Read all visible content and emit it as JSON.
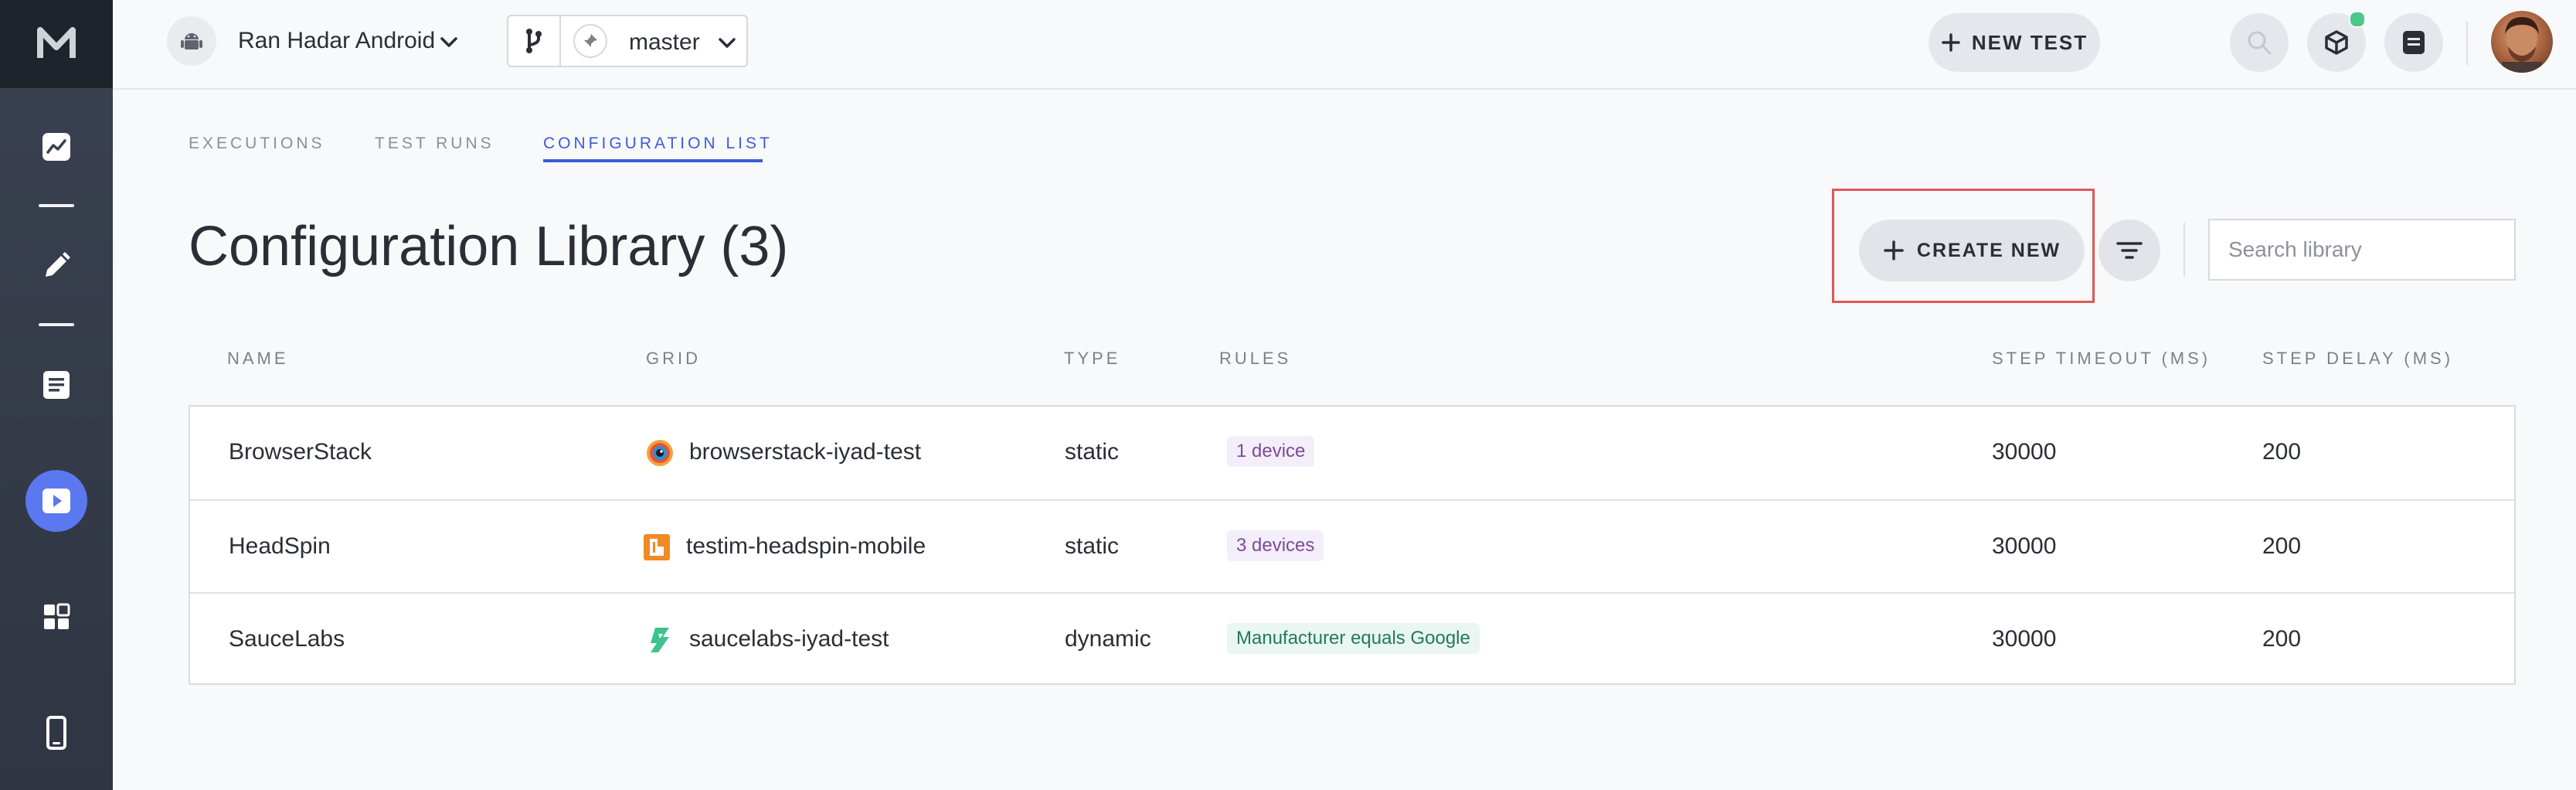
{
  "sidebar": {
    "logo": "M",
    "items": [
      {
        "name": "analytics",
        "icon": "trend-chart-icon"
      },
      {
        "name": "editor",
        "icon": "pencil-icon"
      },
      {
        "name": "tests",
        "icon": "document-list-icon"
      },
      {
        "name": "runs",
        "icon": "play-icon",
        "active": true
      },
      {
        "name": "dashboard",
        "icon": "grid-icon"
      },
      {
        "name": "devices",
        "icon": "mobile-device-icon"
      }
    ]
  },
  "topbar": {
    "project_name": "Ran Hadar Android",
    "project_icon": "android-icon",
    "branch": "master",
    "new_test_label": "NEW TEST"
  },
  "tabs": [
    {
      "label": "EXECUTIONS",
      "active": false
    },
    {
      "label": "TEST RUNS",
      "active": false
    },
    {
      "label": "CONFIGURATION LIST",
      "active": true
    }
  ],
  "library": {
    "title": "Configuration Library (3)",
    "create_label": "CREATE NEW",
    "search_placeholder": "Search library"
  },
  "table": {
    "columns": [
      "NAME",
      "GRID",
      "TYPE",
      "RULES",
      "STEP TIMEOUT (MS)",
      "STEP DELAY (MS)"
    ],
    "rows": [
      {
        "name": "BrowserStack",
        "grid": "browserstack-iyad-test",
        "grid_icon": "browserstack-icon",
        "type": "static",
        "rules": "1 device",
        "rule_style": "purple",
        "timeout": "30000",
        "delay": "200"
      },
      {
        "name": "HeadSpin",
        "grid": "testim-headspin-mobile",
        "grid_icon": "headspin-icon",
        "type": "static",
        "rules": "3 devices",
        "rule_style": "purple",
        "timeout": "30000",
        "delay": "200"
      },
      {
        "name": "SauceLabs",
        "grid": "saucelabs-iyad-test",
        "grid_icon": "saucelabs-icon",
        "type": "dynamic",
        "rules": "Manufacturer equals Google",
        "rule_style": "green",
        "timeout": "30000",
        "delay": "200"
      }
    ]
  },
  "colors": {
    "accent": "#3d5bd9",
    "sidebar_active": "#5b78f0",
    "highlight_border": "#e05757",
    "notification": "#4cc88b"
  }
}
